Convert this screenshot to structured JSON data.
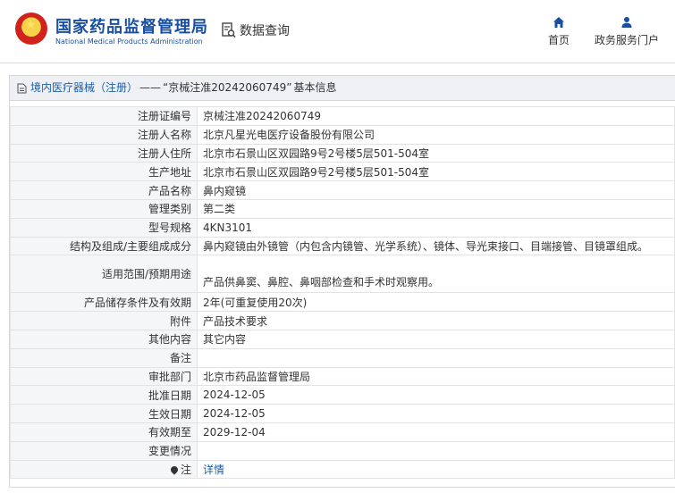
{
  "header": {
    "brand_cn": "国家药品监督管理局",
    "brand_en": "National Medical Products Administration",
    "data_query": "数据查询",
    "nav": [
      {
        "label": "首页",
        "icon": "home-icon"
      },
      {
        "label": "政务服务门户",
        "icon": "user-icon"
      }
    ]
  },
  "breadcrumb": {
    "category": "境内医疗器械（注册）",
    "separator": "——",
    "record": "“京械注准20242060749”",
    "suffix": "基本信息"
  },
  "fields": [
    {
      "label": "注册证编号",
      "value": "京械注准20242060749"
    },
    {
      "label": "注册人名称",
      "value": "北京凡星光电医疗设备股份有限公司"
    },
    {
      "label": "注册人住所",
      "value": "北京市石景山区双园路9号2号楼5层501-504室"
    },
    {
      "label": "生产地址",
      "value": "北京市石景山区双园路9号2号楼5层501-504室"
    },
    {
      "label": "产品名称",
      "value": "鼻内窥镜"
    },
    {
      "label": "管理类别",
      "value": "第二类"
    },
    {
      "label": "型号规格",
      "value": "4KN3101"
    },
    {
      "label": "结构及组成/主要组成成分",
      "value": "鼻内窥镜由外镜管（内包含内镜管、光学系统）、镜体、导光束接口、目端接管、目镜罩组成。"
    },
    {
      "label": "适用范围/预期用途",
      "value": "产品供鼻窦、鼻腔、鼻咽部检查和手术时观察用。"
    },
    {
      "label": "产品储存条件及有效期",
      "value": "2年(可重复使用20次)"
    },
    {
      "label": "附件",
      "value": "产品技术要求"
    },
    {
      "label": "其他内容",
      "value": "其它内容"
    },
    {
      "label": "备注",
      "value": ""
    },
    {
      "label": "审批部门",
      "value": "北京市药品监督管理局"
    },
    {
      "label": "批准日期",
      "value": "2024-12-05"
    },
    {
      "label": "生效日期",
      "value": "2024-12-05"
    },
    {
      "label": "有效期至",
      "value": "2029-12-04"
    },
    {
      "label": "变更情况",
      "value": ""
    },
    {
      "label": "注",
      "value": "详情"
    }
  ],
  "colors": {
    "brand_blue": "#1a4fa0",
    "link_blue": "#1a5ea8",
    "title_bar_bg": "#eef0f4"
  }
}
